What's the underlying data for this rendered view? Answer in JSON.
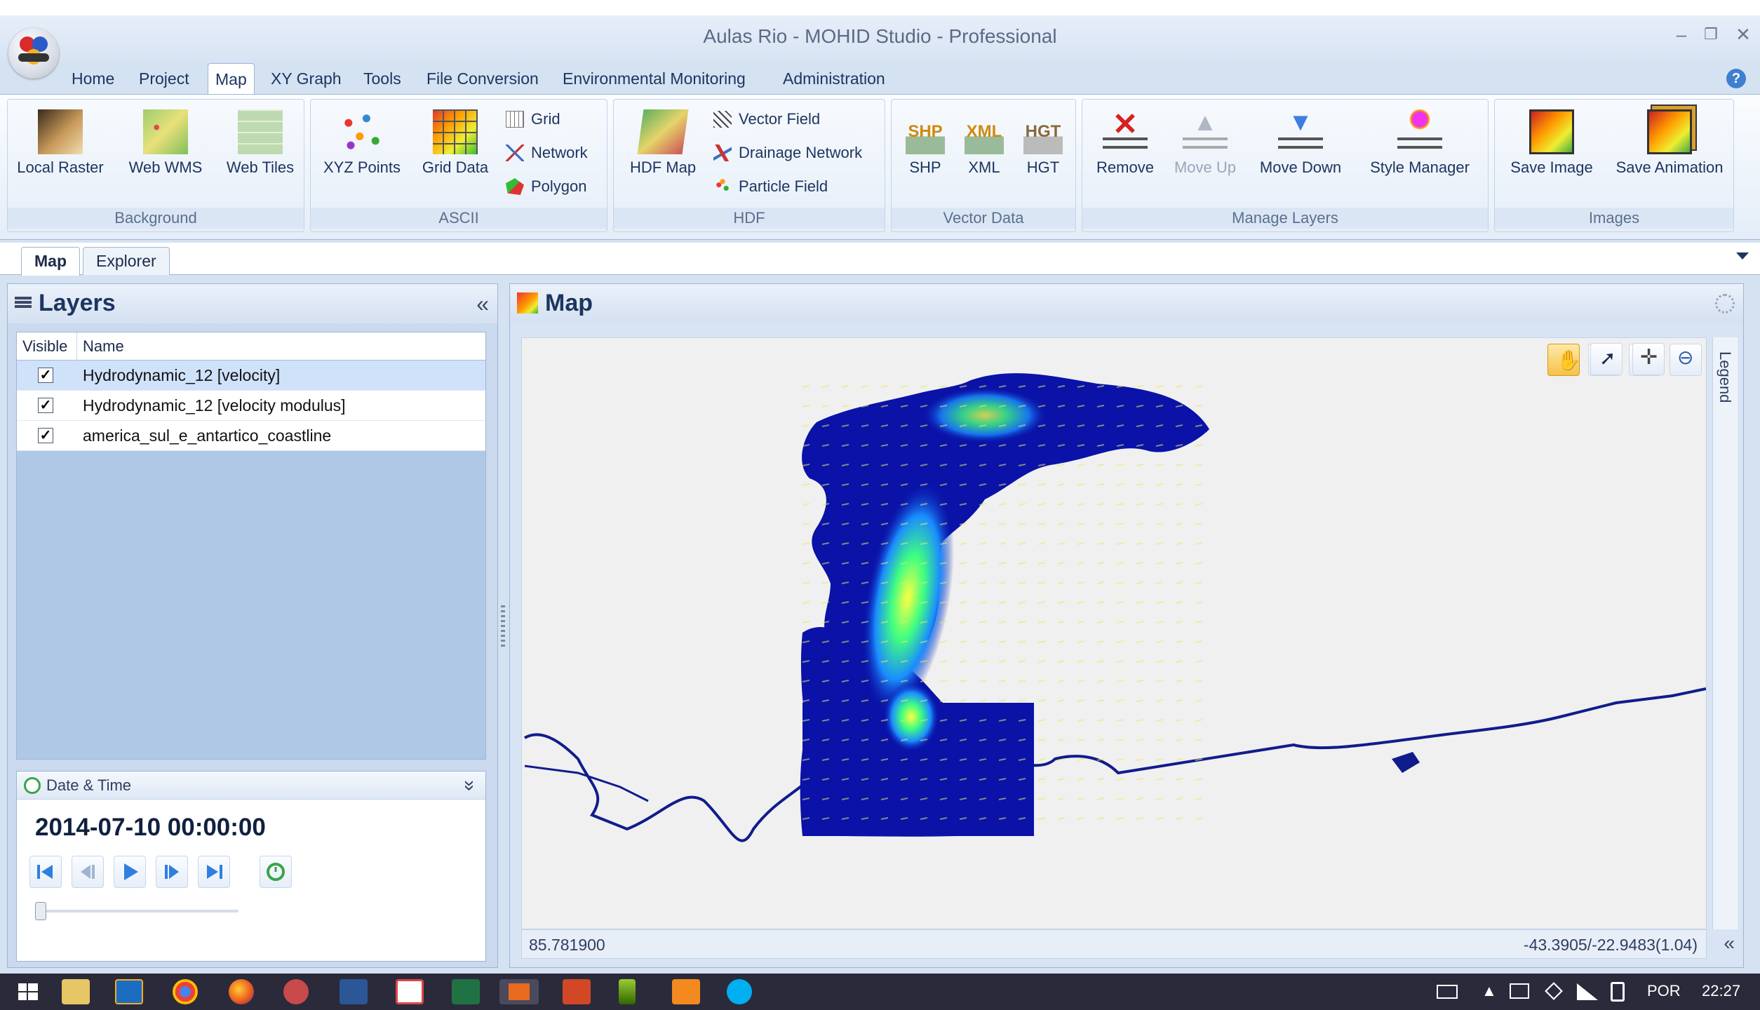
{
  "window": {
    "title": "Aulas Rio - MOHID Studio - Professional",
    "minimize": "–",
    "restore": "❐",
    "close": "✕"
  },
  "menu": {
    "items": [
      "Home",
      "Project",
      "Map",
      "XY Graph",
      "Tools",
      "File Conversion",
      "Environmental Monitoring",
      "Administration"
    ],
    "active": "Map",
    "help": "?"
  },
  "ribbon": {
    "groups": {
      "background": {
        "label": "Background",
        "buttons": [
          "Local Raster",
          "Web WMS",
          "Web Tiles"
        ]
      },
      "ascii": {
        "label": "ASCII",
        "buttons": [
          "XYZ Points",
          "Grid Data"
        ],
        "small": [
          "Grid",
          "Network",
          "Polygon"
        ]
      },
      "hdf": {
        "label": "HDF",
        "buttons": [
          "HDF Map"
        ],
        "small": [
          "Vector Field",
          "Drainage Network",
          "Particle Field"
        ]
      },
      "vector_data": {
        "label": "Vector Data",
        "buttons": [
          "SHP",
          "XML",
          "HGT"
        ]
      },
      "manage_layers": {
        "label": "Manage Layers",
        "buttons": [
          "Remove",
          "Move Up",
          "Move Down",
          "Style Manager"
        ]
      },
      "images": {
        "label": "Images",
        "buttons": [
          "Save Image",
          "Save Animation"
        ]
      }
    }
  },
  "doc_tabs": [
    "Map",
    "Explorer"
  ],
  "layers_panel": {
    "title": "Layers",
    "collapse": "«",
    "columns": [
      "Visible",
      "Name"
    ],
    "rows": [
      {
        "visible": true,
        "name": "Hydrodynamic_12 [velocity]"
      },
      {
        "visible": true,
        "name": "Hydrodynamic_12 [velocity modulus]"
      },
      {
        "visible": true,
        "name": "america_sul_e_antartico_coastline"
      }
    ],
    "check": "✓"
  },
  "datetime": {
    "title": "Date & Time",
    "expand": "»",
    "value": "2014-07-10 00:00:00",
    "slider_position": 0
  },
  "map_panel": {
    "title": "Map",
    "legend": "Legend",
    "status_left": "85.781900",
    "status_right": "-43.3905/-22.9483(1.04)",
    "status_toggle": "«"
  },
  "taskbar": {
    "language": "POR",
    "time": "22:27"
  },
  "colors": {
    "accent": "#1d3560",
    "ribbon_bg": "#e4edf8",
    "map_water": "#0a12a8",
    "coastline": "#101c8c",
    "selected_row": "#cfe2fa"
  }
}
